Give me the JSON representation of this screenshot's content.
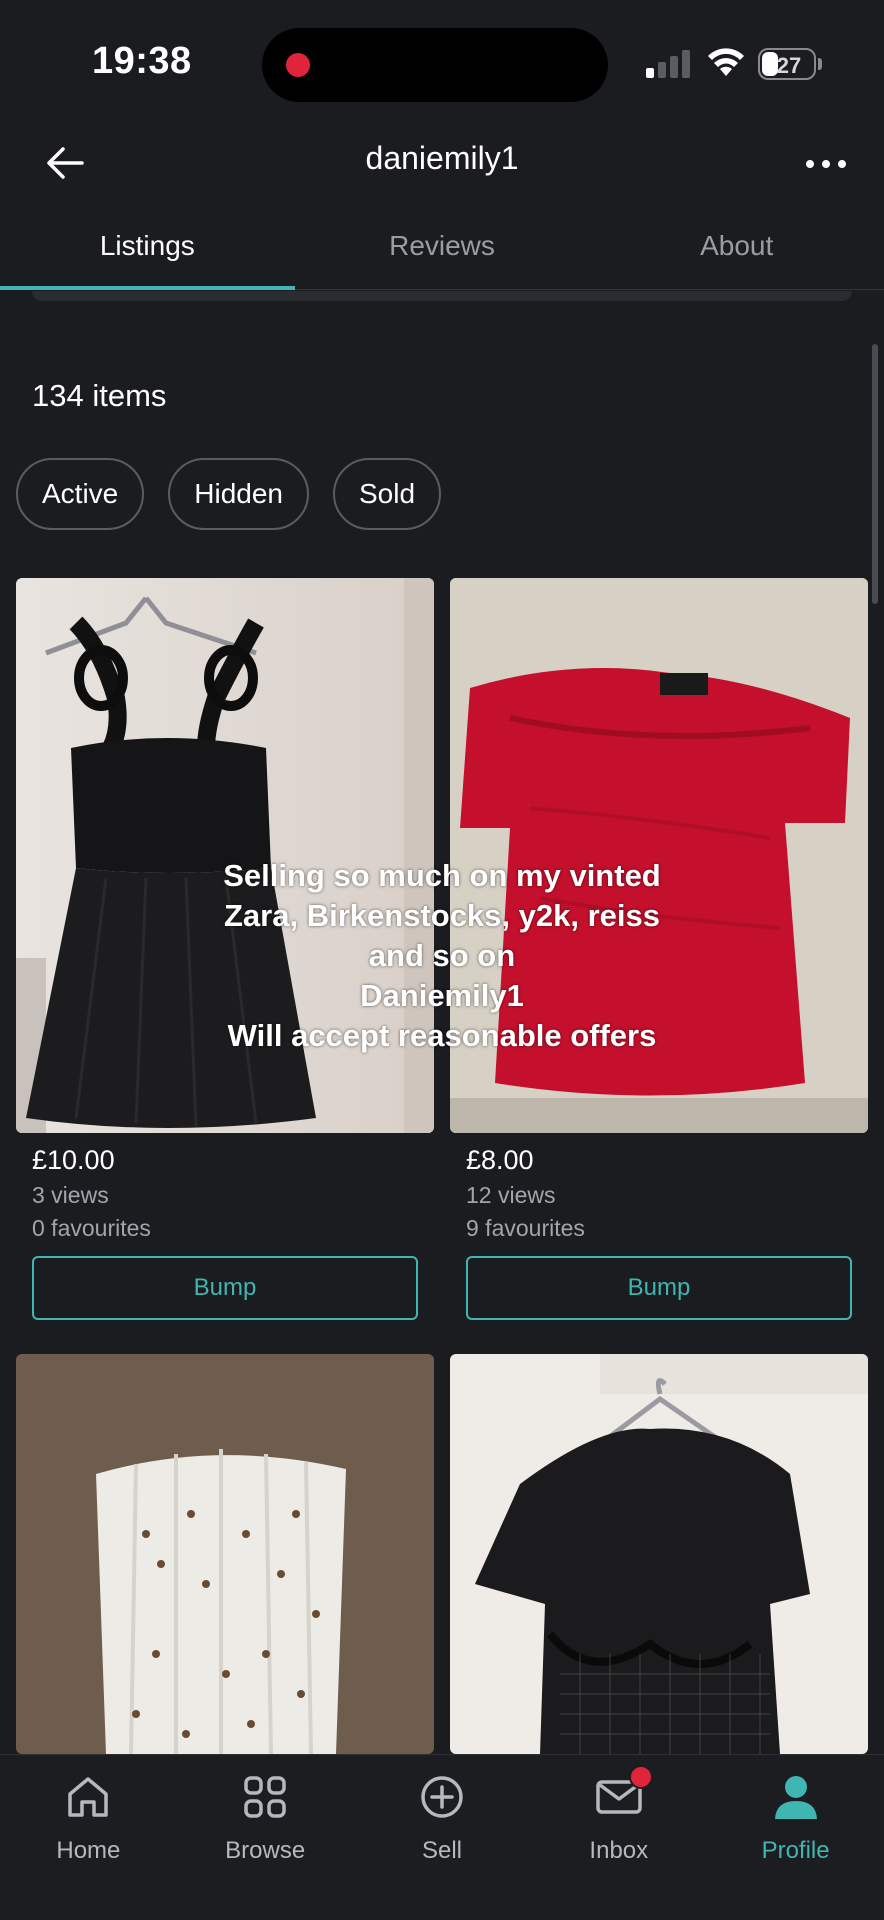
{
  "status": {
    "time": "19:38",
    "battery": "27"
  },
  "header": {
    "title": "daniemily1"
  },
  "tabs": [
    {
      "label": "Listings",
      "active": true
    },
    {
      "label": "Reviews",
      "active": false
    },
    {
      "label": "About",
      "active": false
    }
  ],
  "items_count": "134 items",
  "filters": [
    "Active",
    "Hidden",
    "Sold"
  ],
  "listings": [
    {
      "price": "£10.00",
      "views": "3 views",
      "favourites": "0 favourites",
      "bump_label": "Bump",
      "image": "black-dress"
    },
    {
      "price": "£8.00",
      "views": "12 views",
      "favourites": "9 favourites",
      "bump_label": "Bump",
      "image": "red-top"
    },
    {
      "image": "white-corset"
    },
    {
      "image": "black-mesh-top"
    }
  ],
  "overlay_text": [
    "Selling so much on my vinted",
    "Zara, Birkenstocks, y2k, reiss",
    "and so on",
    "Daniemily1",
    "Will accept reasonable offers"
  ],
  "bottom_nav": [
    {
      "label": "Home",
      "icon": "home-icon",
      "active": false
    },
    {
      "label": "Browse",
      "icon": "browse-icon",
      "active": false
    },
    {
      "label": "Sell",
      "icon": "plus-circle-icon",
      "active": false
    },
    {
      "label": "Inbox",
      "icon": "mail-icon",
      "active": false,
      "badge": true
    },
    {
      "label": "Profile",
      "icon": "profile-icon",
      "active": true
    }
  ],
  "colors": {
    "background": "#1b1c20",
    "accent": "#3fb6b2",
    "badge": "#e0243b",
    "muted_text": "#a3a5aa"
  }
}
